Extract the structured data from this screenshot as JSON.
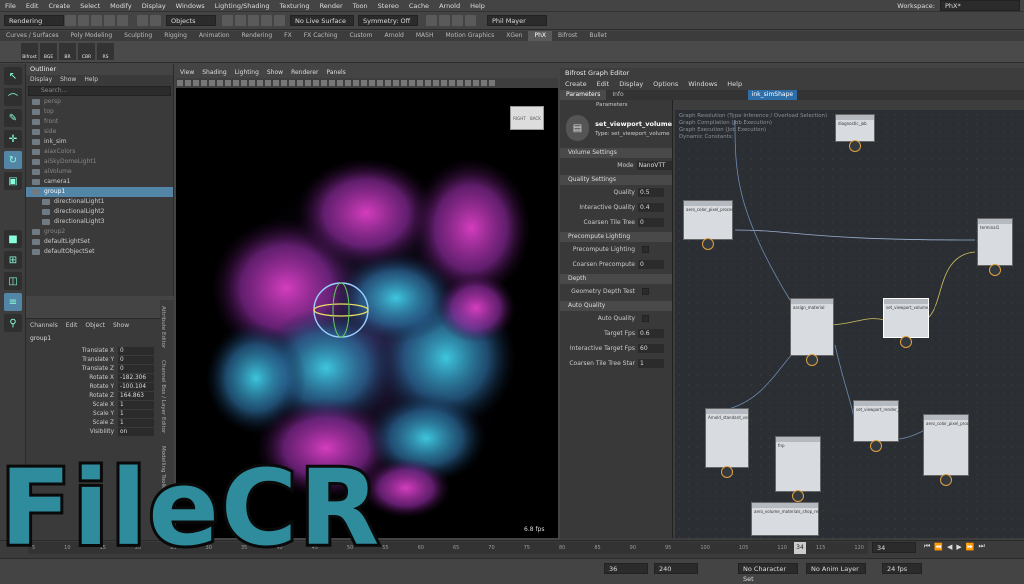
{
  "menu": [
    "File",
    "Edit",
    "Create",
    "Select",
    "Modify",
    "Display",
    "Windows",
    "Lighting/Shading",
    "Texturing",
    "Render",
    "Toon",
    "Stereo",
    "Cache",
    "Arnold",
    "Help"
  ],
  "workspace": {
    "label": "Workspace:",
    "value": "PhX*"
  },
  "status": {
    "mode": "Rendering",
    "objects": "Objects",
    "no_live": "No Live Surface",
    "symmetry": "Symmetry: Off",
    "user": "Phil Mayer"
  },
  "shelf_tabs": [
    "Curves / Surfaces",
    "Poly Modeling",
    "Sculpting",
    "Rigging",
    "Animation",
    "Rendering",
    "FX",
    "FX Caching",
    "Custom",
    "Arnold",
    "MASH",
    "Motion Graphics",
    "XGen",
    "PhX",
    "Bifrost",
    "Bullet"
  ],
  "shelf_active": "PhX",
  "shelf_icons": [
    "Bifrost",
    "BGE",
    "BR",
    "CBR",
    "RS"
  ],
  "outliner": {
    "title": "Outliner",
    "menu": [
      "Display",
      "Show",
      "Help"
    ],
    "search": "Search...",
    "items": [
      {
        "label": "persp",
        "dim": true
      },
      {
        "label": "top",
        "dim": true
      },
      {
        "label": "front",
        "dim": true
      },
      {
        "label": "side",
        "dim": true
      },
      {
        "label": "ink_sim",
        "dim": false
      },
      {
        "label": "aiaxColors",
        "dim": true
      },
      {
        "label": "aiSkyDomeLight1",
        "dim": true
      },
      {
        "label": "aiVolume",
        "dim": true
      },
      {
        "label": "camera1",
        "dim": false
      },
      {
        "label": "group1",
        "dim": false,
        "sel": true
      },
      {
        "label": "directionalLight1",
        "dim": false,
        "indent": 1
      },
      {
        "label": "directionalLight2",
        "dim": false,
        "indent": 1
      },
      {
        "label": "directionalLight3",
        "dim": false,
        "indent": 1
      },
      {
        "label": "group2",
        "dim": true
      },
      {
        "label": "defaultLightSet",
        "dim": false
      },
      {
        "label": "defaultObjectSet",
        "dim": false
      }
    ]
  },
  "channels": {
    "menu": [
      "Channels",
      "Edit",
      "Object",
      "Show"
    ],
    "object": "group1",
    "attrs": [
      {
        "k": "Translate X",
        "v": "0"
      },
      {
        "k": "Translate Y",
        "v": "0"
      },
      {
        "k": "Translate Z",
        "v": "0"
      },
      {
        "k": "Rotate X",
        "v": "-182.306"
      },
      {
        "k": "Rotate Y",
        "v": "-100.104"
      },
      {
        "k": "Rotate Z",
        "v": "164.863"
      },
      {
        "k": "Scale X",
        "v": "1"
      },
      {
        "k": "Scale Y",
        "v": "1"
      },
      {
        "k": "Scale Z",
        "v": "1"
      },
      {
        "k": "Visibility",
        "v": "on"
      }
    ]
  },
  "side_tabs": [
    "Attribute Editor",
    "Channel Box / Layer Editor",
    "Modelling Toolkit"
  ],
  "viewport": {
    "menu": [
      "View",
      "Shading",
      "Lighting",
      "Show",
      "Renderer",
      "Panels"
    ],
    "camera": "persp",
    "fps": "6.8 fps",
    "viewcube": [
      "RIGHT",
      "BACK"
    ]
  },
  "bifrost": {
    "title": "Bifrost Graph Editor",
    "menu": [
      "Create",
      "Edit",
      "Display",
      "Options",
      "Windows",
      "Help"
    ],
    "tabs": [
      "Parameters",
      "Info"
    ],
    "sub": "Parameters",
    "breadcrumb": "ink_simShape",
    "node_name": "set_viewport_volume",
    "node_type": "Type: set_viewport_volume",
    "sections": [
      {
        "title": "Volume Settings",
        "params": [
          {
            "k": "Mode",
            "v": "NanoVTT",
            "kind": "select"
          }
        ]
      },
      {
        "title": "Quality Settings",
        "params": [
          {
            "k": "Quality",
            "v": "0.5"
          },
          {
            "k": "Interactive Quality",
            "v": "0.4"
          },
          {
            "k": "Coarsen Tile Tree",
            "v": "0"
          }
        ]
      },
      {
        "title": "Precompute Lighting",
        "params": [
          {
            "k": "Precompute Lighting",
            "v": "",
            "kind": "check"
          },
          {
            "k": "Coarsen Precompute",
            "v": "0"
          }
        ]
      },
      {
        "title": "Depth",
        "params": [
          {
            "k": "Geometry Depth Test",
            "v": "",
            "kind": "check"
          }
        ]
      },
      {
        "title": "Auto Quality",
        "params": [
          {
            "k": "Auto Quality",
            "v": "",
            "kind": "check"
          },
          {
            "k": "Target Fps",
            "v": "0.6"
          },
          {
            "k": "Interactive Target Fps",
            "v": "60"
          },
          {
            "k": "Coarsen Tile Tree Star",
            "v": "1"
          }
        ]
      }
    ],
    "graph_notes": [
      "Graph Resolution (Type Inference / Overload Selection)",
      "Graph Compilation (Job Execution)",
      "Graph Execution (Job Execution)",
      "Dynamic Constants:"
    ],
    "nodes": [
      "aero_color_pixel_process",
      "diagnostic_job",
      "terminal1",
      "assign_material",
      "set_viewport_volume_settings",
      "set_viewport_render_settings_SPP_1",
      "aero_color_pixel_process1",
      "Arnold_standard_volume_mat",
      "fnp",
      "aero_volume_materials_shop_render_properties1"
    ]
  },
  "timeline": {
    "start": "1",
    "current": "34",
    "ticks": [
      "5",
      "10",
      "15",
      "20",
      "25",
      "30",
      "35",
      "40",
      "45",
      "50",
      "55",
      "60",
      "65",
      "70",
      "75",
      "80",
      "85",
      "90",
      "95",
      "100",
      "105",
      "110",
      "115",
      "120"
    ]
  },
  "range": {
    "start": "36",
    "end": "240",
    "char_set": "No Character Set",
    "anim_layer": "No Anim Layer",
    "fps": "24 fps"
  },
  "watermark": "FileCR"
}
